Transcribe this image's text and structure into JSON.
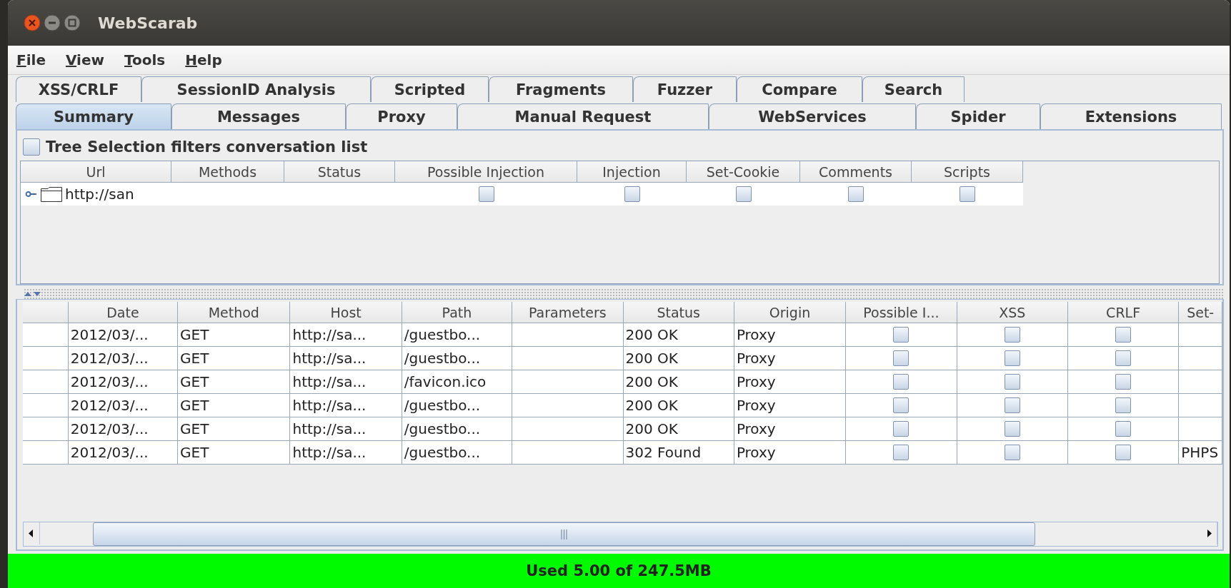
{
  "window": {
    "title": "WebScarab"
  },
  "menu": [
    "File",
    "View",
    "Tools",
    "Help"
  ],
  "tabs": {
    "row_1": [
      {
        "label": "XSS/CRLF",
        "selected": false
      },
      {
        "label": "SessionID Analysis",
        "selected": false
      },
      {
        "label": "Scripted",
        "selected": false
      },
      {
        "label": "Fragments",
        "selected": false
      },
      {
        "label": "Fuzzer",
        "selected": false
      },
      {
        "label": "Compare",
        "selected": false
      },
      {
        "label": "Search",
        "selected": false
      }
    ],
    "row_2": [
      {
        "label": "Summary",
        "selected": true
      },
      {
        "label": "Messages",
        "selected": false
      },
      {
        "label": "Proxy",
        "selected": false
      },
      {
        "label": "Manual Request",
        "selected": false
      },
      {
        "label": "WebServices",
        "selected": false
      },
      {
        "label": "Spider",
        "selected": false
      },
      {
        "label": "Extensions",
        "selected": false
      }
    ]
  },
  "filter_checkbox": {
    "label": "Tree Selection filters conversation list",
    "checked": false
  },
  "tree_table": {
    "columns": [
      "Url",
      "Methods",
      "Status",
      "Possible Injection",
      "Injection",
      "Set-Cookie",
      "Comments",
      "Scripts"
    ],
    "rows": [
      {
        "url": "http://san",
        "checks": [
          false,
          false,
          false,
          false,
          false
        ]
      }
    ]
  },
  "conversation_table": {
    "columns": [
      "Date",
      "Method",
      "Host",
      "Path",
      "Parameters",
      "Status",
      "Origin",
      "Possible I...",
      "XSS",
      "CRLF",
      "Set-"
    ],
    "rows": [
      {
        "date": "2012/03/...",
        "method": "GET",
        "host": "http://sa...",
        "path": "/guestbo...",
        "status": "200 OK",
        "origin": "Proxy",
        "checks": [
          false,
          false,
          false
        ]
      },
      {
        "date": "2012/03/...",
        "method": "GET",
        "host": "http://sa...",
        "path": "/guestbo...",
        "status": "200 OK",
        "origin": "Proxy",
        "checks": [
          false,
          false,
          false
        ]
      },
      {
        "date": "2012/03/...",
        "method": "GET",
        "host": "http://sa...",
        "path": "/favicon.ico",
        "status": "200 OK",
        "origin": "Proxy",
        "checks": [
          false,
          false,
          false
        ]
      },
      {
        "date": "2012/03/...",
        "method": "GET",
        "host": "http://sa...",
        "path": "/guestbo...",
        "status": "200 OK",
        "origin": "Proxy",
        "checks": [
          false,
          false,
          false
        ]
      },
      {
        "date": "2012/03/...",
        "method": "GET",
        "host": "http://sa...",
        "path": "/guestbo...",
        "status": "200 OK",
        "origin": "Proxy",
        "checks": [
          false,
          false,
          false
        ]
      },
      {
        "date": "2012/03/...",
        "method": "GET",
        "host": "http://sa...",
        "path": "/guestbo...",
        "status": "302 Found",
        "origin": "Proxy",
        "checks": [
          false,
          false,
          false
        ],
        "set_cookie": "PHPS"
      }
    ]
  },
  "status_bar": {
    "text": "Used 5.00 of 247.5MB"
  }
}
